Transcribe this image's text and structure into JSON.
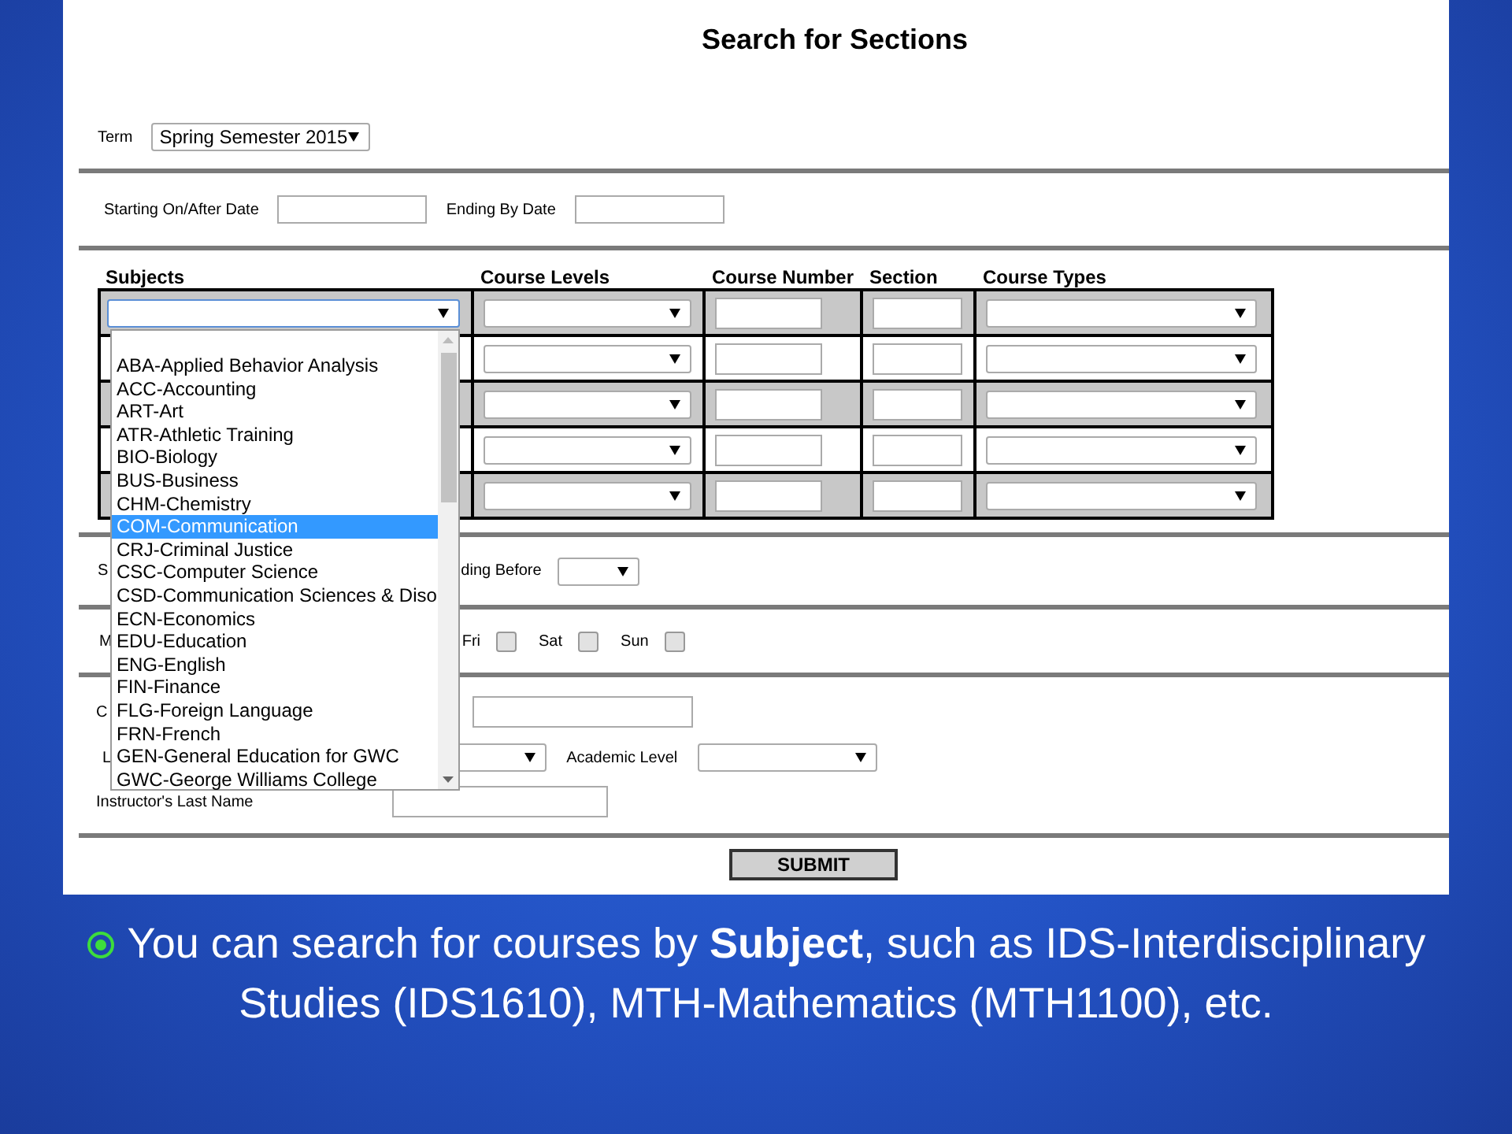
{
  "title": "Search for Sections",
  "term": {
    "label": "Term",
    "value": "Spring Semester 2015"
  },
  "dates": [
    {
      "label": "Starting On/After Date"
    },
    {
      "label": "Ending By Date"
    }
  ],
  "sections_table": {
    "columns": [
      "Subjects",
      "Course Levels",
      "Course Number",
      "Section",
      "Course Types"
    ],
    "rows": [
      {
        "shaded": true
      },
      {
        "shaded": false
      },
      {
        "shaded": true
      },
      {
        "shaded": false
      },
      {
        "shaded": true
      }
    ]
  },
  "subject_dropdown": {
    "open": true,
    "items": [
      {
        "label": "ABA-Applied Behavior Analysis",
        "selected": false
      },
      {
        "label": "ACC-Accounting",
        "selected": false
      },
      {
        "label": "ART-Art",
        "selected": false
      },
      {
        "label": "ATR-Athletic Training",
        "selected": false
      },
      {
        "label": "BIO-Biology",
        "selected": false
      },
      {
        "label": "BUS-Business",
        "selected": false
      },
      {
        "label": "CHM-Chemistry",
        "selected": false
      },
      {
        "label": "COM-Communication",
        "selected": true
      },
      {
        "label": "CRJ-Criminal Justice",
        "selected": false
      },
      {
        "label": "CSC-Computer Science",
        "selected": false
      },
      {
        "label": "CSD-Communication Sciences & Diso",
        "selected": false
      },
      {
        "label": "ECN-Economics",
        "selected": false
      },
      {
        "label": "EDU-Education",
        "selected": false
      },
      {
        "label": "ENG-English",
        "selected": false
      },
      {
        "label": "FIN-Finance",
        "selected": false
      },
      {
        "label": "FLG-Foreign Language",
        "selected": false
      },
      {
        "label": "FRN-French",
        "selected": false
      },
      {
        "label": "GEN-General Education for GWC",
        "selected": false
      },
      {
        "label": "GWC-George Williams College",
        "selected": false
      }
    ]
  },
  "time_row": {
    "label_fragment": "S",
    "ending_label": "ding Before"
  },
  "days_row": {
    "label_fragment": "M",
    "days": [
      {
        "label": "Fri",
        "checked": false
      },
      {
        "label": "Sat",
        "checked": false
      },
      {
        "label": "Sun",
        "checked": false
      }
    ]
  },
  "keyword_row": {
    "label_fragment": "C"
  },
  "level_row": {
    "label_fragment": "L",
    "academic_level_label": "Academic Level"
  },
  "instructor": {
    "label": "Instructor's Last Name"
  },
  "submit": "SUBMIT",
  "caption": {
    "text": "You can search for courses by **Subject**, such as IDS-Interdisciplinary Studies (IDS1610), MTH-Mathematics (MTH1100), etc."
  }
}
